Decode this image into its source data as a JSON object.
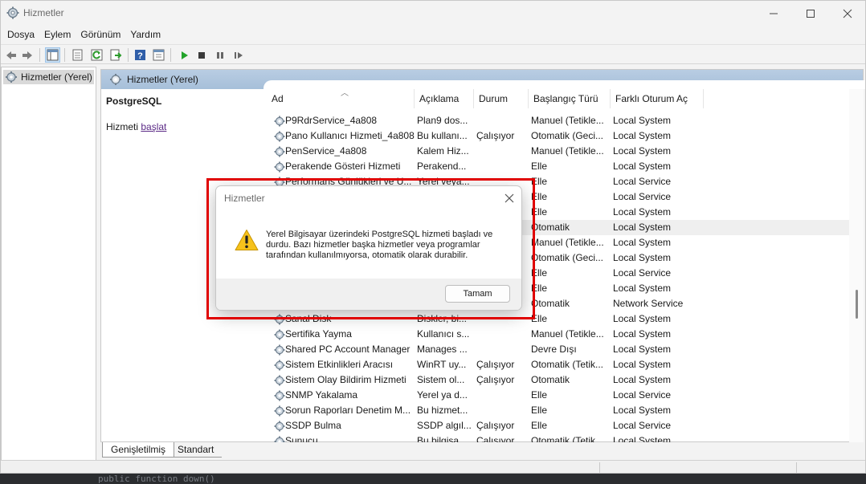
{
  "window": {
    "title": "Hizmetler"
  },
  "menu": [
    "Dosya",
    "Eylem",
    "Görünüm",
    "Yardım"
  ],
  "tree": {
    "root_label": "Hizmetler (Yerel)"
  },
  "panel": {
    "header": "Hizmetler (Yerel)"
  },
  "extended": {
    "service_name": "PostgreSQL",
    "action_prefix": "Hizmeti ",
    "action_link": "başlat"
  },
  "columns": [
    "Ad",
    "Açıklama",
    "Durum",
    "Başlangıç Türü",
    "Farklı Oturum Aç"
  ],
  "rows": [
    {
      "ad": "P9RdrService_4a808",
      "aciklama": "Plan9 dos...",
      "durum": "",
      "baslangic": "Manuel (Tetikle...",
      "oturum": "Local System"
    },
    {
      "ad": "Pano Kullanıcı Hizmeti_4a808",
      "aciklama": "Bu kullanı...",
      "durum": "Çalışıyor",
      "baslangic": "Otomatik (Geci...",
      "oturum": "Local System"
    },
    {
      "ad": "PenService_4a808",
      "aciklama": "Kalem Hiz...",
      "durum": "",
      "baslangic": "Manuel (Tetikle...",
      "oturum": "Local System"
    },
    {
      "ad": "Perakende Gösteri Hizmeti",
      "aciklama": "Perakend...",
      "durum": "",
      "baslangic": "Elle",
      "oturum": "Local System"
    },
    {
      "ad": "Performans Günlükleri ve U...",
      "aciklama": "Yerel veya...",
      "durum": "",
      "baslangic": "Elle",
      "oturum": "Local Service"
    },
    {
      "ad": "",
      "aciklama": "",
      "durum": "",
      "baslangic": "Elle",
      "oturum": "Local Service"
    },
    {
      "ad": "",
      "aciklama": "",
      "durum": "",
      "baslangic": "Elle",
      "oturum": "Local System"
    },
    {
      "ad": "",
      "aciklama": "",
      "durum": "",
      "baslangic": "Otomatik",
      "oturum": "Local System",
      "selected": true
    },
    {
      "ad": "",
      "aciklama": "",
      "durum": "",
      "baslangic": "Manuel (Tetikle...",
      "oturum": "Local System"
    },
    {
      "ad": "",
      "aciklama": "",
      "durum": "",
      "baslangic": "Otomatik (Geci...",
      "oturum": "Local System"
    },
    {
      "ad": "",
      "aciklama": "",
      "durum": "",
      "baslangic": "Elle",
      "oturum": "Local Service"
    },
    {
      "ad": "",
      "aciklama": "",
      "durum": "",
      "baslangic": "Elle",
      "oturum": "Local System"
    },
    {
      "ad": "",
      "aciklama": "",
      "durum": "",
      "baslangic": "Otomatik",
      "oturum": "Network Service"
    },
    {
      "ad": "Sanal Disk",
      "aciklama": "Diskler, bi...",
      "durum": "",
      "baslangic": "Elle",
      "oturum": "Local System"
    },
    {
      "ad": "Sertifika Yayma",
      "aciklama": "Kullanıcı s...",
      "durum": "",
      "baslangic": "Manuel (Tetikle...",
      "oturum": "Local System"
    },
    {
      "ad": "Shared PC Account Manager",
      "aciklama": "Manages ...",
      "durum": "",
      "baslangic": "Devre Dışı",
      "oturum": "Local System"
    },
    {
      "ad": "Sistem Etkinlikleri Aracısı",
      "aciklama": "WinRT uy...",
      "durum": "Çalışıyor",
      "baslangic": "Otomatik (Tetik...",
      "oturum": "Local System"
    },
    {
      "ad": "Sistem Olay Bildirim Hizmeti",
      "aciklama": "Sistem ol...",
      "durum": "Çalışıyor",
      "baslangic": "Otomatik",
      "oturum": "Local System"
    },
    {
      "ad": "SNMP Yakalama",
      "aciklama": "Yerel ya d...",
      "durum": "",
      "baslangic": "Elle",
      "oturum": "Local Service"
    },
    {
      "ad": "Sorun Raporları Denetim M...",
      "aciklama": "Bu hizmet...",
      "durum": "",
      "baslangic": "Elle",
      "oturum": "Local System"
    },
    {
      "ad": "SSDP Bulma",
      "aciklama": "SSDP algıl...",
      "durum": "Çalışıyor",
      "baslangic": "Elle",
      "oturum": "Local Service"
    },
    {
      "ad": "Sunucu",
      "aciklama": "Bu bilgisa...",
      "durum": "Çalışıyor",
      "baslangic": "Otomatik (Tetik...",
      "oturum": "Local System"
    }
  ],
  "tabs": {
    "extended": "Genişletilmiş",
    "standard": "Standart"
  },
  "dialog": {
    "title": "Hizmetler",
    "message": "Yerel Bilgisayar üzerindeki PostgreSQL hizmeti başladı ve durdu. Bazı hizmetler başka hizmetler veya programlar tarafından kullanılmıyorsa, otomatik olarak durabilir.",
    "ok_label": "Tamam"
  },
  "background_code": "public function down()",
  "colors": {
    "highlight": "#e00000",
    "panel_header": "#a6bfd9",
    "link": "#5b2a86"
  },
  "icons": [
    "services-app-icon",
    "back-icon",
    "forward-icon",
    "console-tree-icon",
    "properties-icon",
    "refresh-icon",
    "export-list-icon",
    "help-icon",
    "view-icon",
    "play-icon",
    "stop-icon",
    "pause-icon",
    "resume-icon",
    "gear-icon",
    "warning-icon",
    "close-icon"
  ]
}
